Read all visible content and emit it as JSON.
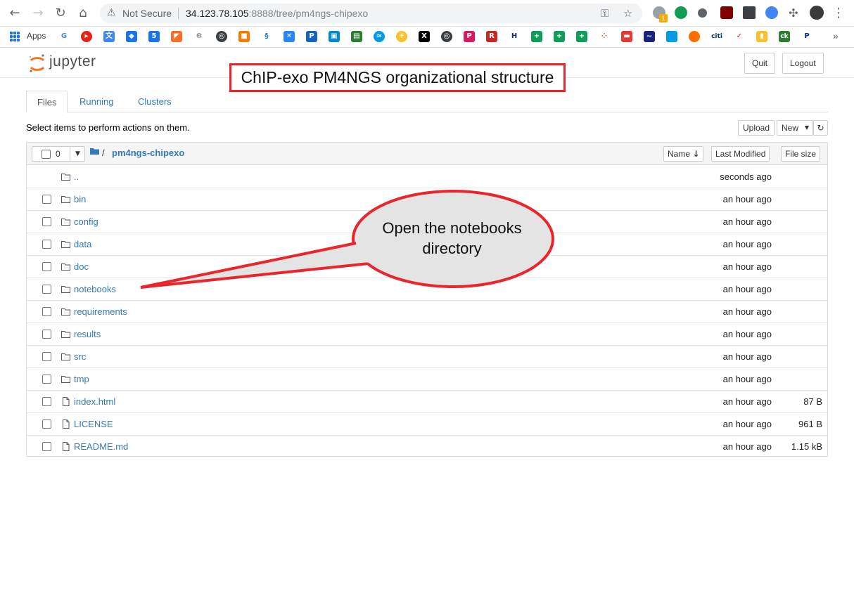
{
  "browser": {
    "not_secure": "Not Secure",
    "url_host": "34.123.78.105",
    "url_port": ":8888",
    "url_path": "/tree/pm4ngs-chipexo",
    "bookmarks_apps_label": "Apps",
    "extension_badge": "1"
  },
  "header": {
    "logo_text": "jupyter",
    "quit_label": "Quit",
    "logout_label": "Logout"
  },
  "annotations": {
    "title": "ChIP-exo PM4NGS organizational structure",
    "callout_line1": "Open the notebooks",
    "callout_line2": "directory",
    "color": "#e8262c"
  },
  "tabs": [
    {
      "label": "Files",
      "active": true
    },
    {
      "label": "Running",
      "active": false
    },
    {
      "label": "Clusters",
      "active": false
    }
  ],
  "toolbar": {
    "select_message": "Select items to perform actions on them.",
    "upload_label": "Upload",
    "new_label": "New",
    "refresh_icon": "refresh-icon"
  },
  "list_header": {
    "selected_count": "0",
    "breadcrumb_sep": "/",
    "breadcrumb_folder": "pm4ngs-chipexo",
    "sort_name": "Name",
    "sort_modified": "Last Modified",
    "sort_size": "File size"
  },
  "rows": [
    {
      "type": "parent",
      "name": "..",
      "modified": "seconds ago",
      "size": ""
    },
    {
      "type": "folder",
      "name": "bin",
      "modified": "an hour ago",
      "size": ""
    },
    {
      "type": "folder",
      "name": "config",
      "modified": "an hour ago",
      "size": ""
    },
    {
      "type": "folder",
      "name": "data",
      "modified": "an hour ago",
      "size": ""
    },
    {
      "type": "folder",
      "name": "doc",
      "modified": "an hour ago",
      "size": ""
    },
    {
      "type": "folder",
      "name": "notebooks",
      "modified": "an hour ago",
      "size": ""
    },
    {
      "type": "folder",
      "name": "requirements",
      "modified": "an hour ago",
      "size": ""
    },
    {
      "type": "folder",
      "name": "results",
      "modified": "an hour ago",
      "size": ""
    },
    {
      "type": "folder",
      "name": "src",
      "modified": "an hour ago",
      "size": ""
    },
    {
      "type": "folder",
      "name": "tmp",
      "modified": "an hour ago",
      "size": ""
    },
    {
      "type": "file",
      "name": "index.html",
      "modified": "an hour ago",
      "size": "87 B"
    },
    {
      "type": "file",
      "name": "LICENSE",
      "modified": "an hour ago",
      "size": "961 B"
    },
    {
      "type": "file",
      "name": "README.md",
      "modified": "an hour ago",
      "size": "1.15 kB"
    }
  ],
  "colors": {
    "link": "#337ab7",
    "jupyter_orange": "#f37726",
    "annotation_red": "#e8262c"
  }
}
